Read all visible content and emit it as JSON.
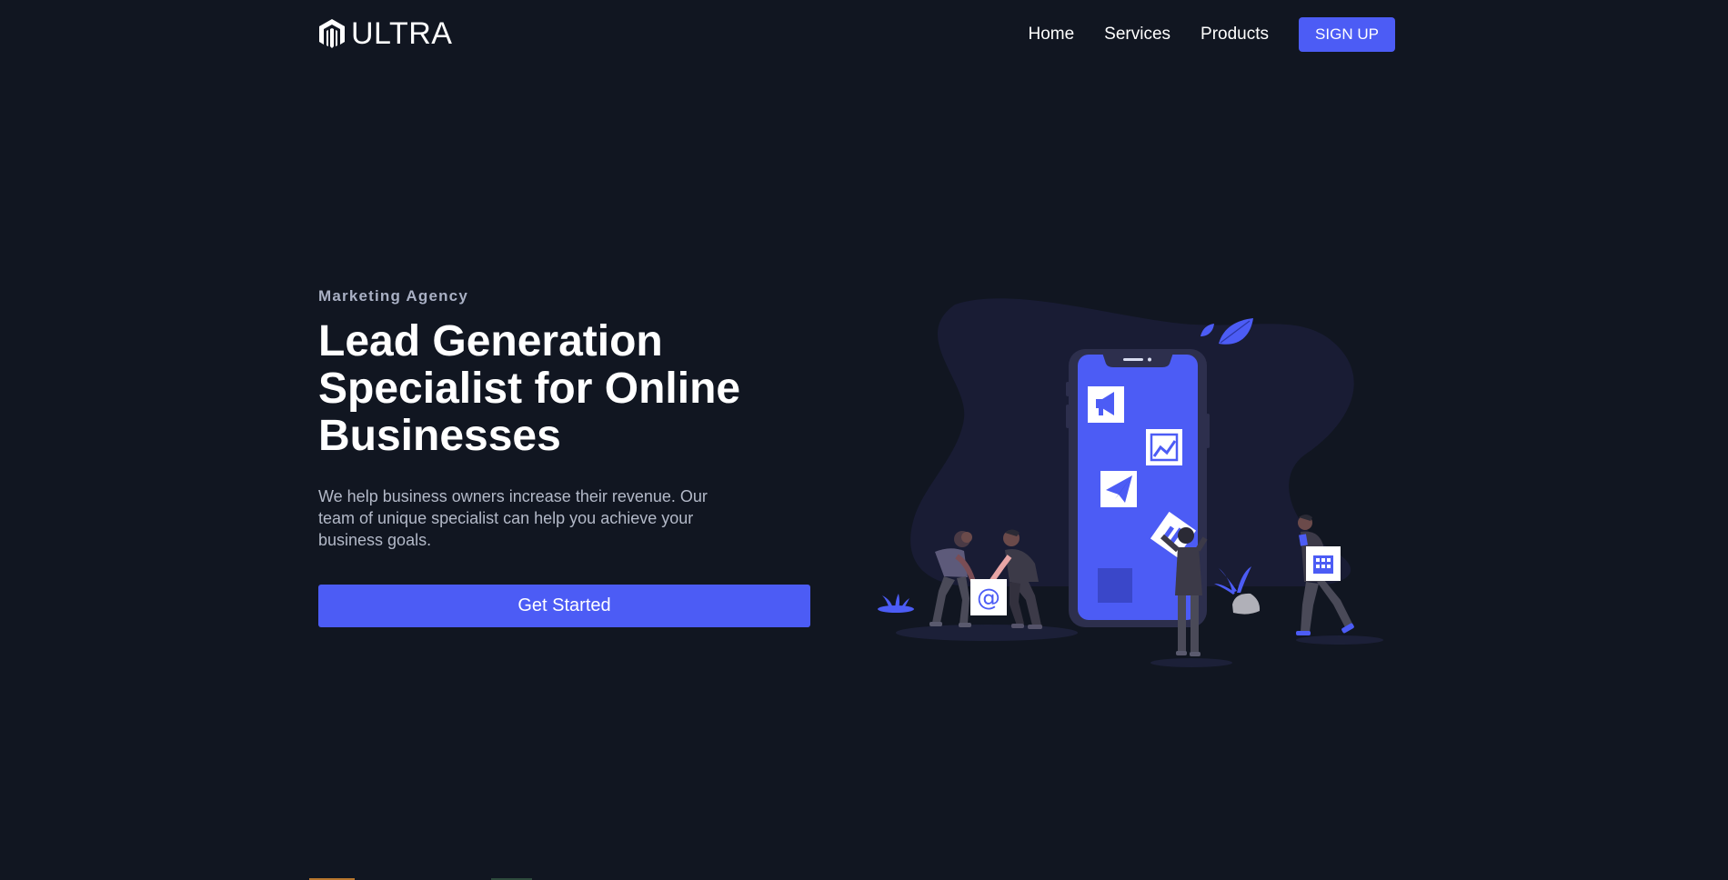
{
  "nav": {
    "logo_text": "ULTRA",
    "links": [
      {
        "label": "Home"
      },
      {
        "label": "Services"
      },
      {
        "label": "Products"
      }
    ],
    "signup_label": "SIGN UP"
  },
  "hero": {
    "eyebrow": "Marketing Agency",
    "headline_lines": [
      "Lead Generation",
      "Specialist for Online",
      "Businesses"
    ],
    "description": "We help business owners increase their revenue. Our team of unique specialist can help you achieve your business goals.",
    "cta_label": "Get Started"
  },
  "illustration": {
    "email_symbol": "@"
  },
  "colors": {
    "background": "#111621",
    "accent": "#4c5cf5",
    "blob": "#191c34",
    "muted_text": "#b3b9c8"
  },
  "icons": [
    "ultra-logo-icon",
    "megaphone-icon",
    "chart-icon",
    "paper-plane-icon",
    "building-icon",
    "at-sign-icon"
  ]
}
